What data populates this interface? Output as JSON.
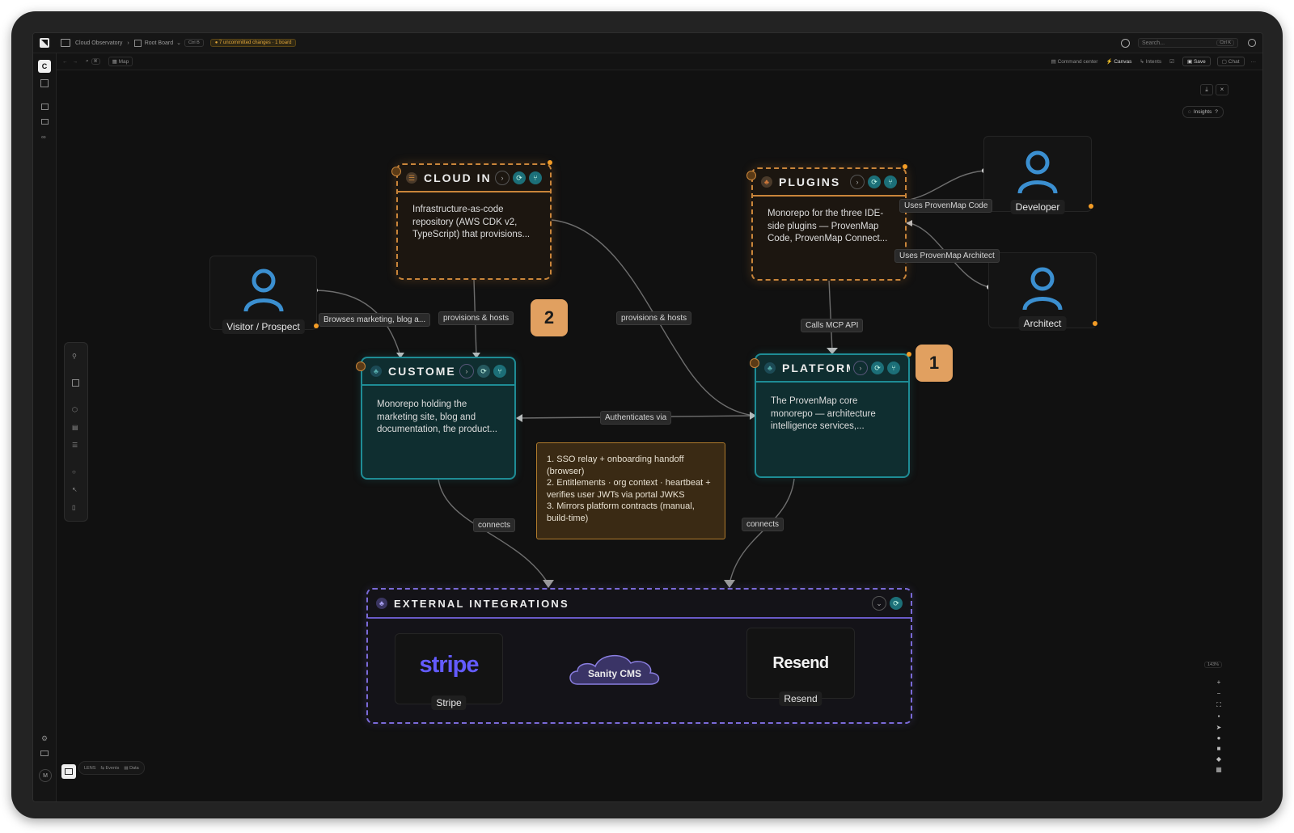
{
  "topbar": {
    "workspace": "Cloud Observatory",
    "board": "Root Board",
    "board_shortcut": "Ctrl B",
    "uncommitted": "7 uncommitted changes",
    "uncommitted_board": "1 board",
    "search_placeholder": "Search...",
    "search_shortcut": "Ctrl K"
  },
  "toolbar": {
    "map_label": "Map",
    "command_center": "Command center",
    "canvas": "Canvas",
    "intents": "Intents",
    "save": "Save",
    "chat": "Chat"
  },
  "rail": {
    "workspace_letter": "C",
    "user_letter": "M"
  },
  "insights_label": "Insights",
  "bottom_bar": {
    "lens": "LENS",
    "events": "Events",
    "data": "Data"
  },
  "zoom_level": "143%",
  "nodes": {
    "cloud": {
      "title": "CLOUD IN...",
      "body": "Infrastructure-as-code repository (AWS CDK v2, TypeScript) that provisions..."
    },
    "plugins": {
      "title": "PLUGINS",
      "body": "Monorepo for the three IDE-side plugins — ProvenMap Code, ProvenMap Connect..."
    },
    "customer": {
      "title": "CUSTOME...",
      "body": "Monorepo holding the marketing site, blog and documentation, the product..."
    },
    "platform": {
      "title": "PLATFORM",
      "body": "The ProvenMap core monorepo — architecture intelligence services,..."
    },
    "external": {
      "title": "EXTERNAL INTEGRATIONS"
    }
  },
  "persons": {
    "visitor": "Visitor / Prospect",
    "developer": "Developer",
    "architect": "Architect"
  },
  "edges": {
    "browses": "Browses marketing, blog a...",
    "provisions_hosts_1": "provisions & hosts",
    "provisions_hosts_2": "provisions & hosts",
    "uses_code": "Uses ProvenMap Code",
    "uses_architect": "Uses ProvenMap Architect",
    "calls_mcp": "Calls MCP API",
    "authenticates": "Authenticates via",
    "connects_1": "connects",
    "connects_2": "connects"
  },
  "badges": {
    "one": "1",
    "two": "2"
  },
  "note": {
    "line1": "1. SSO relay + onboarding handoff (browser)",
    "line2": "2. Entitlements · org context · heartbeat + verifies user JWTs via portal JWKS",
    "line3": "3. Mirrors platform contracts (manual, build-time)"
  },
  "integrations": {
    "stripe_logo": "stripe",
    "stripe_label": "Stripe",
    "sanity": "Sanity CMS",
    "resend_logo": "Resend",
    "resend_label": "Resend"
  },
  "colors": {
    "accent_teal": "#1e8c95",
    "accent_orange": "#d88a3a",
    "accent_purple": "#7a6ad8",
    "stripe": "#635bff"
  }
}
